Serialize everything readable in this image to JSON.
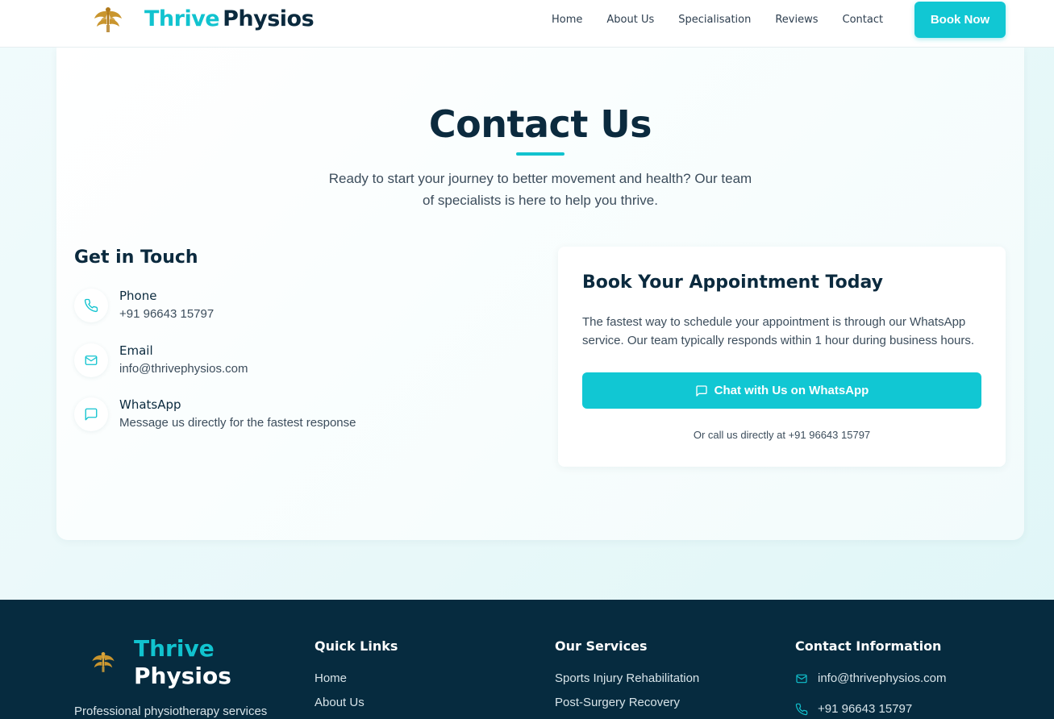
{
  "nav": {
    "brand_part1": "Thrive",
    "brand_part2": "Physios",
    "links": [
      "Home",
      "About Us",
      "Specialisation",
      "Reviews",
      "Contact"
    ],
    "cta": "Book Now"
  },
  "contact_section": {
    "title": "Contact Us",
    "subtitle": "Ready to start your journey to better movement and health? Our team of specialists is here to help you thrive.",
    "get_in_touch": {
      "heading": "Get in Touch",
      "items": [
        {
          "label": "Phone",
          "value": "+91 96643 15797",
          "icon": "phone-icon"
        },
        {
          "label": "Email",
          "value": "info@thrivephysios.com",
          "icon": "mail-icon"
        },
        {
          "label": "WhatsApp",
          "value": "Message us directly for the fastest response",
          "icon": "chat-icon"
        }
      ]
    },
    "booking": {
      "heading": "Book Your Appointment Today",
      "text": "The fastest way to schedule your appointment is through our WhatsApp service. Our team typically responds within 1 hour during business hours.",
      "button": "Chat with Us on WhatsApp",
      "call_text": "Or call us directly at +91 96643 15797"
    }
  },
  "footer": {
    "brand_part1": "Thrive",
    "brand_part2": "Physios",
    "description": "Professional physiotherapy services",
    "quick_links": {
      "title": "Quick Links",
      "links": [
        "Home",
        "About Us"
      ]
    },
    "services": {
      "title": "Our Services",
      "links": [
        "Sports Injury Rehabilitation",
        "Post-Surgery Recovery"
      ]
    },
    "contact": {
      "title": "Contact Information",
      "email": "info@thrivephysios.com",
      "phone": "+91 96643 15797"
    }
  },
  "colors": {
    "accent": "#11c7d3",
    "navy": "#0b2a3e",
    "footer_bg": "#062b3f"
  }
}
